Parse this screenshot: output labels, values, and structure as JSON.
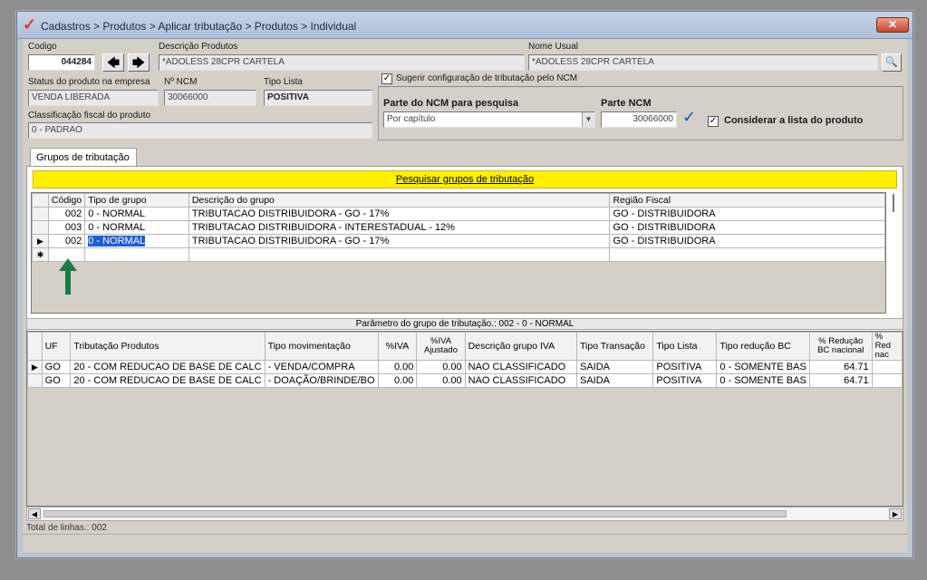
{
  "window": {
    "title": "Cadastros > Produtos > Aplicar tributação > Produtos > Individual",
    "close_label": "✕"
  },
  "header": {
    "codigo_label": "Codigo",
    "codigo_value": "044284",
    "descricao_label": "Descrição  Produtos",
    "descricao_value": "*ADOLESS 28CPR CARTELA",
    "nome_usual_label": "Nome Usual",
    "nome_usual_value": "*ADOLESS 28CPR CARTELA",
    "status_label": "Status do produto na empresa",
    "status_value": "VENDA LIBERADA",
    "ncm_label": "Nº NCM",
    "ncm_value": "30066000",
    "tipo_lista_label": "Tipo Lista",
    "tipo_lista_value": "POSITIVA",
    "classificacao_label": "Classificação fiscal do produto",
    "classificacao_value": "0 - PADRAO",
    "sugerir_label": "Sugerir configuração de tributação pelo NCM",
    "parte_ncm_pesquisa_label": "Parte do NCM para pesquisa",
    "parte_ncm_pesquisa_value": "Por capítulo",
    "parte_ncm_label": "Parte NCM",
    "parte_ncm_value": "30066000",
    "considerar_label": "Considerar a lista do produto"
  },
  "tab": {
    "label": "Grupos de tributação"
  },
  "search_bar_label": "Pesquisar grupos de tributação",
  "groups_grid": {
    "columns": [
      "Código",
      "Tipo de grupo",
      "Descrição do grupo",
      "Região Fiscal"
    ],
    "rows": [
      [
        "002",
        "0 - NORMAL",
        "TRIBUTACAO DISTRIBUIDORA - GO - 17%",
        "GO - DISTRIBUIDORA"
      ],
      [
        "003",
        "0 - NORMAL",
        "TRIBUTACAO DISTRIBUIDORA - INTERESTADUAL - 12%",
        "GO - DISTRIBUIDORA"
      ],
      [
        "002",
        "0 - NORMAL",
        "TRIBUTACAO DISTRIBUIDORA - GO - 17%",
        "GO - DISTRIBUIDORA"
      ]
    ],
    "new_row_marker": "✱"
  },
  "param_title": "Parâmetro do grupo de tributação.: 002 - 0 - NORMAL",
  "param_grid": {
    "columns": [
      "UF",
      "Tributação Produtos",
      "Tipo movimentação",
      "%IVA",
      "%IVA Ajustado",
      "Descrição grupo IVA",
      "Tipo Transação",
      "Tipo Lista",
      "Tipo redução BC",
      "% Redução BC nacional",
      "% Red nac"
    ],
    "rows": [
      [
        "GO",
        "20 - COM REDUCAO DE BASE DE CALC",
        "- VENDA/COMPRA",
        "0.00",
        "0.00",
        "NAO CLASSIFICADO",
        "SAIDA",
        "POSITIVA",
        "0 - SOMENTE BAS",
        "64.71",
        ""
      ],
      [
        "GO",
        "20 - COM REDUCAO DE BASE DE CALC",
        "- DOAÇÃO/BRINDE/BO",
        "0.00",
        "0.00",
        "NAO CLASSIFICADO",
        "SAIDA",
        "POSITIVA",
        "0 - SOMENTE BAS",
        "64.71",
        ""
      ]
    ]
  },
  "total_label": "Total de linhas.: 002",
  "colors": {
    "accent_yellow": "#ffef00",
    "selection": "#1f5fd6",
    "arrow_green": "#1c7a4a"
  }
}
